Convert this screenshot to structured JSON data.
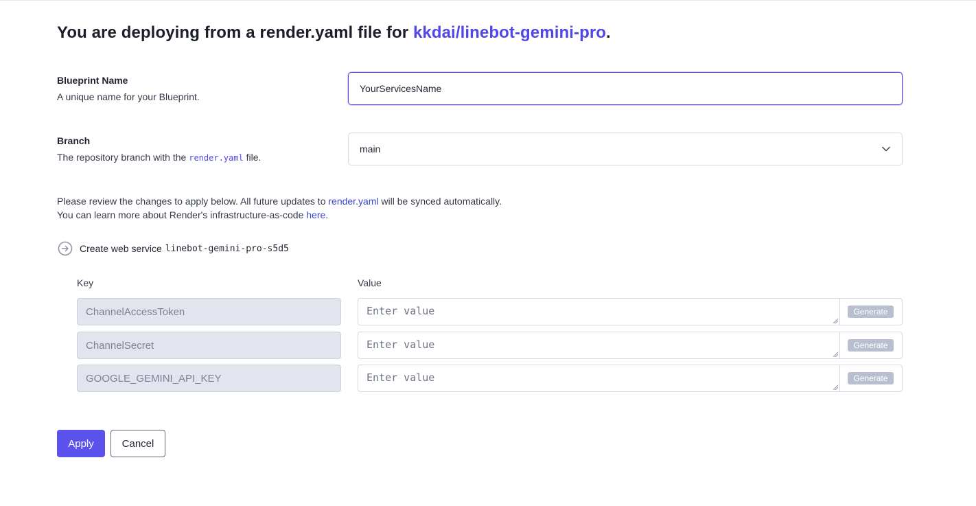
{
  "heading": {
    "prefix": "You are deploying from a render.yaml file for ",
    "repo": "kkdai/linebot-gemini-pro",
    "suffix": "."
  },
  "blueprint": {
    "label": "Blueprint Name",
    "description": "A unique name for your Blueprint.",
    "value": "YourServicesName"
  },
  "branch": {
    "label": "Branch",
    "description_prefix": "The repository branch with the ",
    "description_code": "render.yaml",
    "description_suffix": " file.",
    "selected": "main"
  },
  "info": {
    "line1_prefix": "Please review the changes to apply below. All future updates to ",
    "line1_link": "render.yaml",
    "line1_suffix": " will be synced automatically.",
    "line2_prefix": "You can learn more about Render's infrastructure-as-code ",
    "line2_link": "here",
    "line2_suffix": "."
  },
  "service": {
    "action": "Create web service",
    "name": "linebot-gemini-pro-s5d5",
    "icon": "arrow-right-circle-icon"
  },
  "env_table": {
    "key_header": "Key",
    "value_header": "Value",
    "rows": [
      {
        "key": "ChannelAccessToken",
        "value_placeholder": "Enter value",
        "generate_label": "Generate"
      },
      {
        "key": "ChannelSecret",
        "value_placeholder": "Enter value",
        "generate_label": "Generate"
      },
      {
        "key": "GOOGLE_GEMINI_API_KEY",
        "value_placeholder": "Enter value",
        "generate_label": "Generate"
      }
    ]
  },
  "actions": {
    "apply_label": "Apply",
    "cancel_label": "Cancel"
  },
  "colors": {
    "accent": "#5048e5",
    "link": "#3b46c9",
    "apply_bg": "#5b52ec",
    "disabled_button": "#b8c0d0"
  }
}
